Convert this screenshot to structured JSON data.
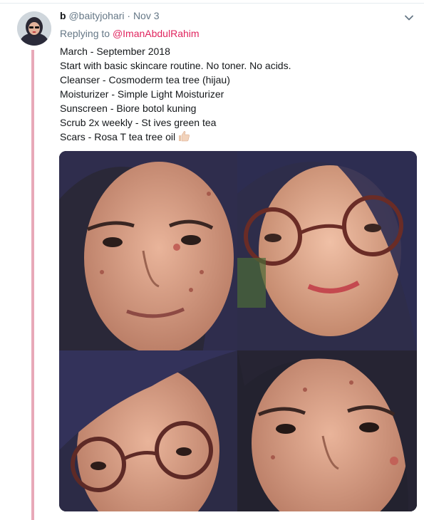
{
  "tweet": {
    "display_name": "b",
    "handle": "@baityjohari",
    "separator": "·",
    "date": "Nov 3",
    "replying_prefix": "Replying to",
    "replying_to": "@ImanAbdulRahim",
    "lines": [
      "March - September 2018",
      "Start with basic skincare routine. No toner. No acids.",
      "Cleanser - Cosmoderm tea tree (hijau)",
      "Moisturizer - Simple Light Moisturizer",
      "Sunscreen - Biore botol kuning",
      "Scrub 2x weekly - St ives green tea",
      "Scars - Rosa T tea tree oil"
    ],
    "emoji": "thumbs-up-emoji"
  },
  "colors": {
    "thread_line": "#e8a9b8",
    "link": "#e0245e",
    "meta_text": "#657786",
    "hijab": "#2e2d50"
  },
  "icons": {
    "menu": "chevron-down-icon",
    "avatar": "avatar"
  },
  "media": {
    "photo_count": 4
  }
}
